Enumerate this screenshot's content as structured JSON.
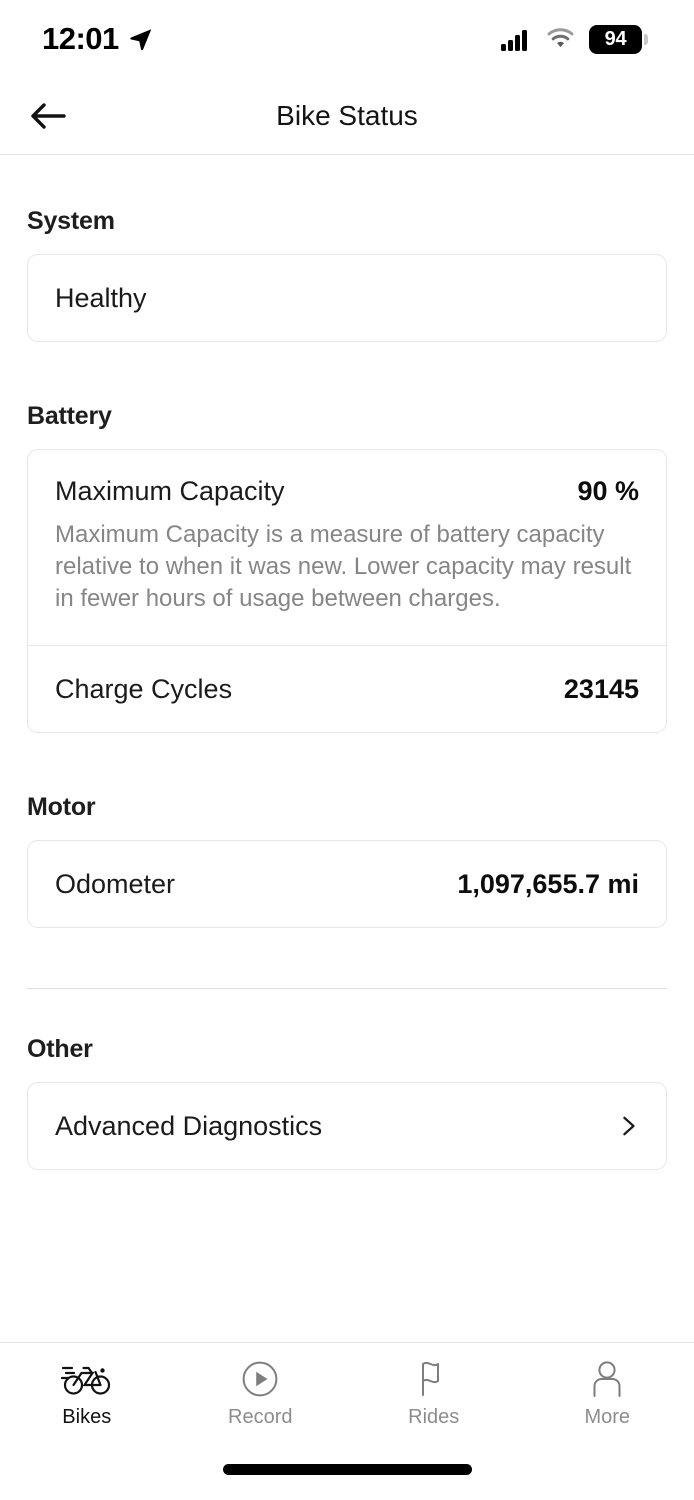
{
  "status_bar": {
    "time": "12:01",
    "location_icon": "location-arrow-icon",
    "cellular_icon": "cellular-bars-icon",
    "wifi_icon": "wifi-icon",
    "battery_level": "94"
  },
  "header": {
    "back_icon": "back-arrow-icon",
    "title": "Bike Status"
  },
  "sections": {
    "system": {
      "title": "System",
      "status": "Healthy"
    },
    "battery": {
      "title": "Battery",
      "max_capacity_label": "Maximum Capacity",
      "max_capacity_value": "90 %",
      "max_capacity_description": "Maximum Capacity is a measure of battery capacity relative to when it was new. Lower capacity may result in fewer hours of usage between charges.",
      "charge_cycles_label": "Charge Cycles",
      "charge_cycles_value": "23145"
    },
    "motor": {
      "title": "Motor",
      "odometer_label": "Odometer",
      "odometer_value": "1,097,655.7 mi"
    },
    "other": {
      "title": "Other",
      "advanced_diagnostics_label": "Advanced Diagnostics",
      "chevron_icon": "chevron-right-icon"
    }
  },
  "tab_bar": {
    "tabs": [
      {
        "label": "Bikes",
        "icon": "bicycle-icon",
        "active": true
      },
      {
        "label": "Record",
        "icon": "play-circle-icon",
        "active": false
      },
      {
        "label": "Rides",
        "icon": "flag-icon",
        "active": false
      },
      {
        "label": "More",
        "icon": "person-icon",
        "active": false
      }
    ]
  },
  "colors": {
    "accent": "#000000",
    "border": "#e6e6e6",
    "muted_text": "#868686",
    "tab_inactive": "#8d8d8d"
  }
}
